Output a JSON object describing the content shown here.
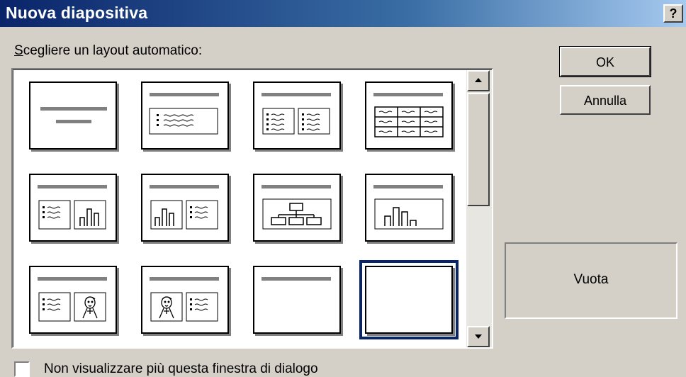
{
  "dialog": {
    "title": "Nuova diapositiva",
    "help_label": "?"
  },
  "prompt": {
    "accel": "S",
    "rest": "cegliere un layout automatico:"
  },
  "buttons": {
    "ok_label": "OK",
    "cancel_label": "Annulla"
  },
  "layouts": [
    {
      "kind": "title-slide"
    },
    {
      "kind": "bulleted-list"
    },
    {
      "kind": "two-column-text"
    },
    {
      "kind": "table"
    },
    {
      "kind": "text-and-chart"
    },
    {
      "kind": "chart-and-text"
    },
    {
      "kind": "organization-chart"
    },
    {
      "kind": "chart"
    },
    {
      "kind": "text-and-clip-art"
    },
    {
      "kind": "clip-art-and-text"
    },
    {
      "kind": "title-only"
    },
    {
      "kind": "blank",
      "selected": true
    }
  ],
  "preview": {
    "selected_name": "Vuota"
  },
  "checkbox": {
    "label": "Non visualizzare più questa finestra di dialogo",
    "checked": false
  },
  "colors": {
    "titlebar_start": "#0a246a",
    "titlebar_end": "#a6caf0",
    "dialog_face": "#d4d0c8",
    "selection": "#0a246a"
  }
}
